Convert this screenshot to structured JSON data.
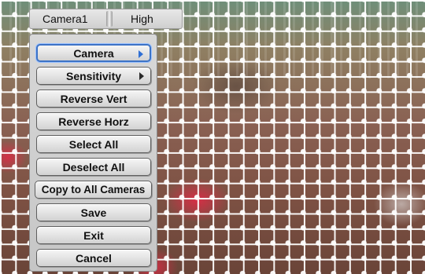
{
  "status_bar": {
    "camera_name": "Camera1",
    "quality": "High"
  },
  "menu": {
    "items": [
      {
        "label": "Camera",
        "has_submenu": true,
        "selected": true
      },
      {
        "label": "Sensitivity",
        "has_submenu": true,
        "selected": false
      },
      {
        "label": "Reverse Vert",
        "has_submenu": false,
        "selected": false
      },
      {
        "label": "Reverse Horz",
        "has_submenu": false,
        "selected": false
      },
      {
        "label": "Select All",
        "has_submenu": false,
        "selected": false
      },
      {
        "label": "Deselect All",
        "has_submenu": false,
        "selected": false
      },
      {
        "label": "Copy to All Cameras",
        "has_submenu": false,
        "selected": false
      },
      {
        "label": "Save",
        "has_submenu": false,
        "selected": false
      },
      {
        "label": "Exit",
        "has_submenu": false,
        "selected": false
      },
      {
        "label": "Cancel",
        "has_submenu": false,
        "selected": false
      }
    ]
  },
  "colors": {
    "selection_border": "#3d73c6",
    "grid": "#ffffff"
  }
}
